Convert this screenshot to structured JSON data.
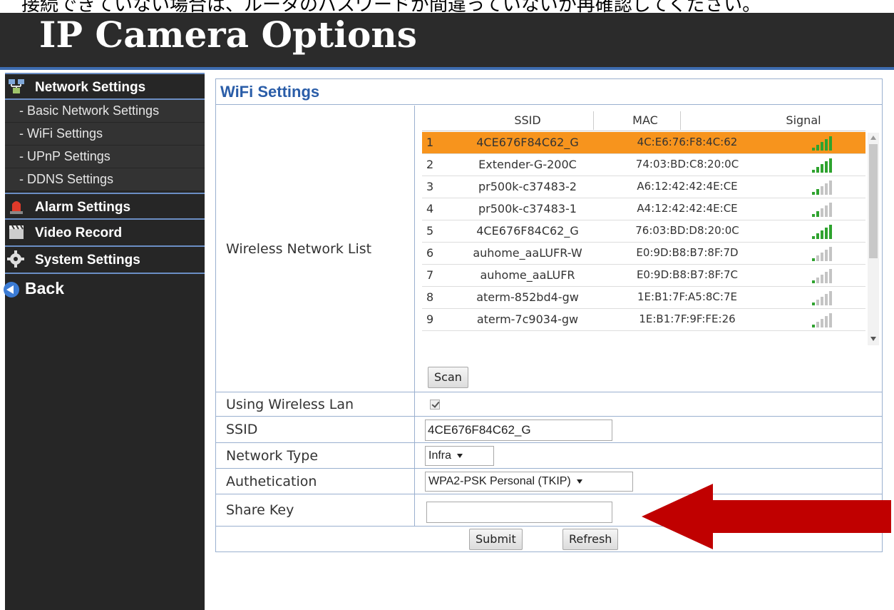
{
  "caption": "接続できていない場合は、ルータのパスワードが間違っていないか再確認してください。",
  "title": "IP Camera Options",
  "sidebar": {
    "network_settings": "Network Settings",
    "sub_items": [
      "- Basic Network Settings",
      "- WiFi Settings",
      "- UPnP Settings",
      "- DDNS Settings"
    ],
    "alarm_settings": "Alarm Settings",
    "video_record": "Video Record",
    "system_settings": "System Settings",
    "back": "Back"
  },
  "panel": {
    "title": "WiFi Settings",
    "wireless_list_label": "Wireless Network List",
    "columns": {
      "ssid": "SSID",
      "mac": "MAC",
      "signal": "Signal"
    },
    "networks": [
      {
        "num": "1",
        "ssid": "4CE676F84C62_G",
        "mac": "4C:E6:76:F8:4C:62",
        "signal_bars": 5,
        "selected": true
      },
      {
        "num": "2",
        "ssid": "Extender-G-200C",
        "mac": "74:03:BD:C8:20:0C",
        "signal_bars": 5,
        "selected": false
      },
      {
        "num": "3",
        "ssid": "pr500k-c37483-2",
        "mac": "A6:12:42:42:4E:CE",
        "signal_bars": 2,
        "selected": false
      },
      {
        "num": "4",
        "ssid": "pr500k-c37483-1",
        "mac": "A4:12:42:42:4E:CE",
        "signal_bars": 2,
        "selected": false
      },
      {
        "num": "5",
        "ssid": "4CE676F84C62_G",
        "mac": "76:03:BD:D8:20:0C",
        "signal_bars": 5,
        "selected": false
      },
      {
        "num": "6",
        "ssid": "auhome_aaLUFR-W",
        "mac": "E0:9D:B8:B7:8F:7D",
        "signal_bars": 1,
        "selected": false
      },
      {
        "num": "7",
        "ssid": "auhome_aaLUFR",
        "mac": "E0:9D:B8:B7:8F:7C",
        "signal_bars": 1,
        "selected": false
      },
      {
        "num": "8",
        "ssid": "aterm-852bd4-gw",
        "mac": "1E:B1:7F:A5:8C:7E",
        "signal_bars": 1,
        "selected": false
      },
      {
        "num": "9",
        "ssid": "aterm-7c9034-gw",
        "mac": "1E:B1:7F:9F:FE:26",
        "signal_bars": 1,
        "selected": false
      }
    ],
    "scan_button": "Scan",
    "using_wireless_lan_label": "Using Wireless Lan",
    "using_wireless_lan_checked": true,
    "ssid_label": "SSID",
    "ssid_value": "4CE676F84C62_G",
    "network_type_label": "Network Type",
    "network_type_value": "Infra",
    "authentication_label": "Authetication",
    "authentication_value": "WPA2-PSK Personal (TKIP)",
    "share_key_label": "Share Key",
    "share_key_value": "",
    "submit_button": "Submit",
    "refresh_button": "Refresh"
  },
  "colors": {
    "selected_row": "#f7941d",
    "signal_green": "#2fa32f",
    "signal_gray": "#c4c4c4",
    "accent_blue": "#2a5da8",
    "arrow_red": "#c00000"
  }
}
